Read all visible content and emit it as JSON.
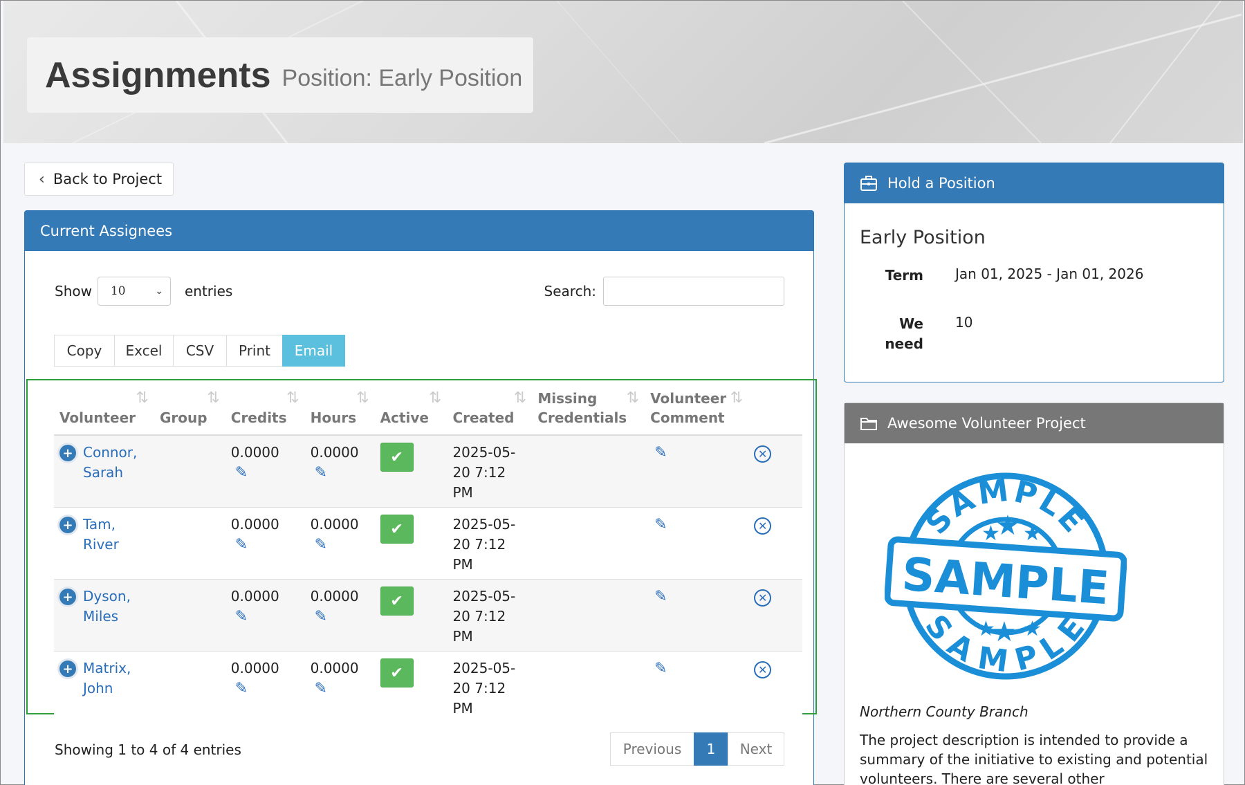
{
  "header": {
    "title": "Assignments",
    "subtitle": "Position: Early Position"
  },
  "nav": {
    "back_label": "Back to Project"
  },
  "assignees_panel": {
    "title": "Current Assignees",
    "show_label": "Show",
    "page_size": "10",
    "entries_label": "entries",
    "search_label": "Search:",
    "search_value": "",
    "export_buttons": [
      "Copy",
      "Excel",
      "CSV",
      "Print",
      "Email"
    ],
    "columns": [
      "Volunteer",
      "Group",
      "Credits",
      "Hours",
      "Active",
      "Created",
      "Missing Credentials",
      "Volunteer Comment"
    ],
    "rows": [
      {
        "name": "Connor, Sarah",
        "group": "",
        "credits": "0.0000",
        "hours": "0.0000",
        "active": true,
        "created": "2025-05-20 7:12 PM"
      },
      {
        "name": "Tam, River",
        "group": "",
        "credits": "0.0000",
        "hours": "0.0000",
        "active": true,
        "created": "2025-05-20 7:12 PM"
      },
      {
        "name": "Dyson, Miles",
        "group": "",
        "credits": "0.0000",
        "hours": "0.0000",
        "active": true,
        "created": "2025-05-20 7:12 PM"
      },
      {
        "name": "Matrix, John",
        "group": "",
        "credits": "0.0000",
        "hours": "0.0000",
        "active": true,
        "created": "2025-05-20 7:12 PM"
      }
    ],
    "summary": "Showing 1 to 4 of 4 entries",
    "pager": {
      "prev": "Previous",
      "current": "1",
      "next": "Next"
    }
  },
  "hold_panel": {
    "title": "Hold a Position",
    "position_name": "Early Position",
    "term_label": "Term",
    "term_value": "Jan 01, 2025 - Jan 01, 2026",
    "need_label": "We need",
    "need_value": "10"
  },
  "project_panel": {
    "title": "Awesome Volunteer Project",
    "branch": "Northern County Branch",
    "description": "The project description is intended to provide a summary of the initiative to existing and potential volunteers. There are several other",
    "stamp_text": "SAMPLE"
  },
  "colors": {
    "primary": "#337ab7",
    "success": "#5cb85c",
    "info": "#5bc0de",
    "highlight_border": "#2e9e3a"
  }
}
